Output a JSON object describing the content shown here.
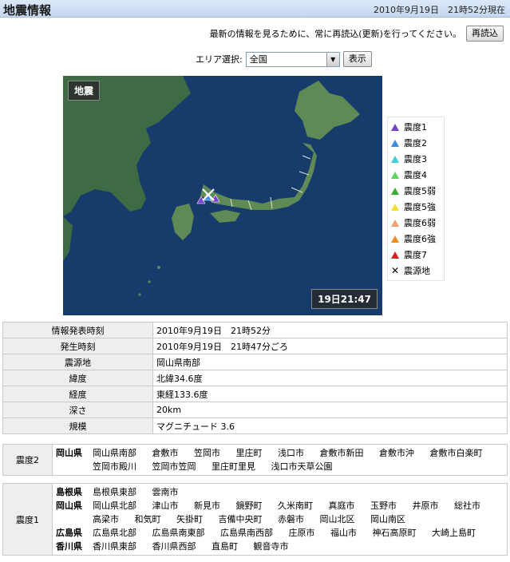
{
  "header": {
    "title": "地震情報",
    "timestamp": "2010年9月19日　21時52分現在"
  },
  "notice": {
    "text": "最新の情報を見るために、常に再読込(更新)を行ってください。",
    "reload_button": "再読込"
  },
  "area": {
    "label": "エリア選択:",
    "selected": "全国",
    "show_button": "表示"
  },
  "map": {
    "label": "地震",
    "time": "19日21:47"
  },
  "legend": [
    {
      "label": "震度1",
      "color": "#7a3fd0"
    },
    {
      "label": "震度2",
      "color": "#3a8ee6"
    },
    {
      "label": "震度3",
      "color": "#3fd0d6"
    },
    {
      "label": "震度4",
      "color": "#5cd65c"
    },
    {
      "label": "震度5弱",
      "color": "#2fb02f"
    },
    {
      "label": "震度5強",
      "color": "#f2e02a"
    },
    {
      "label": "震度6弱",
      "color": "#f0a070"
    },
    {
      "label": "震度6強",
      "color": "#f08a1a"
    },
    {
      "label": "震度7",
      "color": "#e02020"
    },
    {
      "label": "震源地",
      "icon": "cross-icon"
    }
  ],
  "info": [
    {
      "key": "情報発表時刻",
      "value": "2010年9月19日　21時52分"
    },
    {
      "key": "発生時刻",
      "value": "2010年9月19日　21時47分ごろ"
    },
    {
      "key": "震源地",
      "value": "岡山県南部"
    },
    {
      "key": "緯度",
      "value": "北緯34.6度"
    },
    {
      "key": "経度",
      "value": "東経133.6度"
    },
    {
      "key": "深さ",
      "value": "20km"
    },
    {
      "key": "規模",
      "value": "マグニチュード 3.6"
    }
  ],
  "shindo2": {
    "level": "震度2",
    "prefectures": [
      {
        "name": "岡山県",
        "cities": [
          "岡山県南部",
          "倉敷市",
          "笠岡市",
          "里庄町",
          "浅口市",
          "倉敷市新田",
          "倉敷市沖",
          "倉敷市白楽町",
          "笠岡市殿川",
          "笠岡市笠岡",
          "里庄町里見",
          "浅口市天草公園"
        ]
      }
    ]
  },
  "shindo1": {
    "level": "震度1",
    "prefectures": [
      {
        "name": "島根県",
        "cities": [
          "島根県東部",
          "雲南市"
        ]
      },
      {
        "name": "岡山県",
        "cities": [
          "岡山県北部",
          "津山市",
          "新見市",
          "鏡野町",
          "久米南町",
          "真庭市",
          "玉野市",
          "井原市",
          "総社市",
          "高梁市",
          "和気町",
          "矢掛町",
          "吉備中央町",
          "赤磐市",
          "岡山北区",
          "岡山南区"
        ]
      },
      {
        "name": "広島県",
        "cities": [
          "広島県北部",
          "広島県南東部",
          "広島県南西部",
          "庄原市",
          "福山市",
          "神石高原町",
          "大崎上島町"
        ]
      },
      {
        "name": "香川県",
        "cities": [
          "香川県東部",
          "香川県西部",
          "直島町",
          "観音寺市"
        ]
      }
    ]
  }
}
